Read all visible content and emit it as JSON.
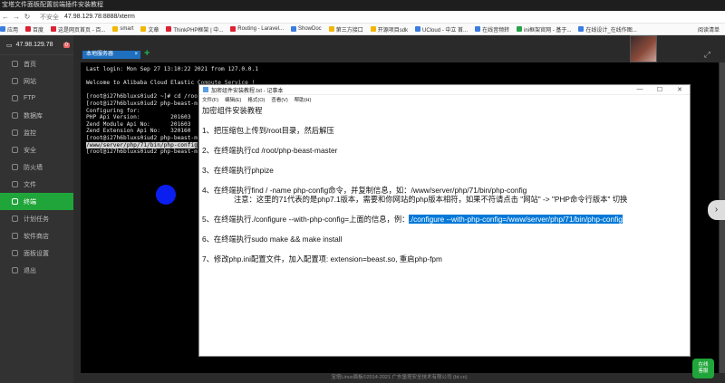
{
  "browser": {
    "window_title": "宝塔文件面板配置前端插件安装教程",
    "security": "不安全",
    "url": "47.98.129.78:8888/xterm",
    "bookmarks": [
      "应用",
      "百度",
      "这是网页首页 - 百...",
      "smart",
      "文章",
      "ThinkPHP框架 | 中...",
      "Routing - Laravel...",
      "ShowDoc",
      "第三方接口",
      "开源项目sdk",
      "UCloud - 中立 首...",
      "在线音频转",
      "ini框架官网 - 基于...",
      "在线设计_在线作图..."
    ],
    "reading_list": "阅读清单"
  },
  "sidebar": {
    "server_ip": "47.98.129.78",
    "badge": "0",
    "items": [
      {
        "label": "首页",
        "active": false
      },
      {
        "label": "网站",
        "active": false
      },
      {
        "label": "FTP",
        "active": false
      },
      {
        "label": "数据库",
        "active": false
      },
      {
        "label": "监控",
        "active": false
      },
      {
        "label": "安全",
        "active": false
      },
      {
        "label": "防火墙",
        "active": false
      },
      {
        "label": "文件",
        "active": false
      },
      {
        "label": "终端",
        "active": true
      },
      {
        "label": "计划任务",
        "active": false
      },
      {
        "label": "软件商店",
        "active": false
      },
      {
        "label": "面板设置",
        "active": false
      },
      {
        "label": "退出",
        "active": false
      }
    ]
  },
  "tabs": {
    "active_tab": "本地服务器",
    "close": "×",
    "add": "+"
  },
  "terminal": {
    "lines": [
      {
        "text": "Last login: Mon Sep 27 13:10:22 2021 from 127.0.0.1",
        "hl": false
      },
      {
        "text": "",
        "hl": false
      },
      {
        "text": "Welcome to Alibaba Cloud Elastic Compute Service !",
        "hl": false
      },
      {
        "text": "",
        "hl": false
      },
      {
        "text": "[root@i27h6bluxs0iud2 ~]# cd /roo",
        "hl": false
      },
      {
        "text": "[root@i27h6bluxs0iud2 php-beast-m",
        "hl": false
      },
      {
        "text": "Configuring for:",
        "hl": false
      },
      {
        "text": "PHP Api Version:         201603",
        "hl": false
      },
      {
        "text": "Zend Module Api No:      201603",
        "hl": false
      },
      {
        "text": "Zend Extension Api No:   320160",
        "hl": false
      },
      {
        "text": "[root@i27h6bluxs0iud2 php-beast-m",
        "hl": false
      },
      {
        "text": "/www/server/php/71/bin/php-config",
        "hl": true
      },
      {
        "text": "[root@i27h6bluxs0iud2 php-beast-m",
        "hl": false
      }
    ]
  },
  "notepad": {
    "title": "加密组件安装教程.txt - 记事本",
    "menus": [
      "文件(F)",
      "编辑(E)",
      "格式(O)",
      "查看(V)",
      "帮助(H)"
    ],
    "controls": [
      "—",
      "☐",
      "✕"
    ],
    "heading": "加密组件安装教程",
    "step1": "1、把压缩包上传到/root目录，然后解压",
    "step2": "2、在终端执行cd /root/php-beast-master",
    "step3": "3、在终端执行phpize",
    "step4": "4、在终端执行find / -name php-config命令，并复制信息，如：/www/server/php/71/bin/php-config",
    "step4_note": "注意：这里的71代表的是php7.1版本，需要和你网站的php版本相符，如果不符请点击 \"网站\" -> \"PHP命令行版本\" 切换",
    "step5_prefix": "5、在终端执行./configure --with-php-config=上面的信息，例：",
    "step5_selected": "./configure --with-php-config=/www/server/php/71/bin/php-config",
    "step6": "6、在终端执行sudo make && make install",
    "step7": "7、修改php.ini配置文件，加入配置项: extension=beast.so, 重启php-fpm"
  },
  "footer": "宝塔Linux面板©2014-2021 广东堡塔安全技术有限公司 (bt.cn)",
  "service_button": [
    "在线",
    "客服"
  ],
  "expand_icon": "expand-icon",
  "colors": {
    "accent": "#20a53a",
    "selection": "#0078d7",
    "tab": "#1f6fbf"
  }
}
